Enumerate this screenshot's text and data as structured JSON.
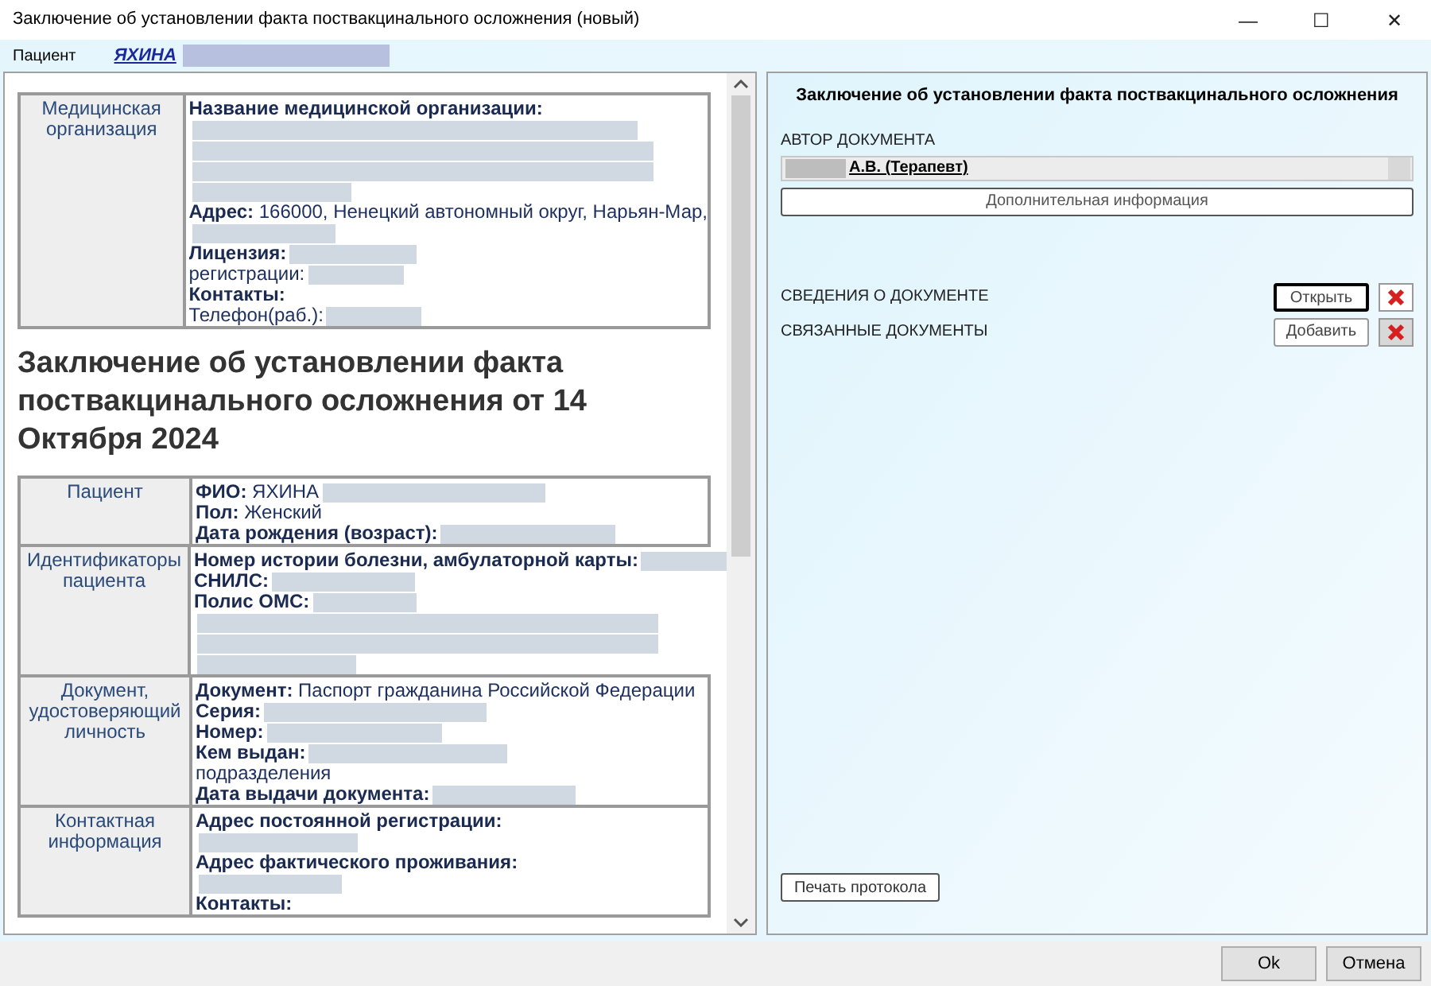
{
  "window": {
    "title": "Заключение об установлении факта поствакцинального осложнения (новый)",
    "controls": [
      "—",
      "☐",
      "✕"
    ]
  },
  "patient_bar": {
    "label": "Пациент",
    "name": "ЯХИНА"
  },
  "document": {
    "org_table": [
      {
        "label": "Медицинская организация",
        "lines": [
          {
            "kind": "field",
            "label": "Название медицинской организации:",
            "redacted": false
          },
          {
            "kind": "blur"
          },
          {
            "kind": "blur"
          },
          {
            "kind": "blur"
          },
          {
            "kind": "blur"
          },
          {
            "kind": "field",
            "label": "Адрес:",
            "value": "166000, Ненецкий автономный округ, Нарьян-Мар,",
            "redacted": false
          },
          {
            "kind": "blur"
          },
          {
            "kind": "field",
            "label": "Лицензия:",
            "redacted": true
          },
          {
            "kind": "text",
            "value": "регистрации:",
            "redacted": true
          },
          {
            "kind": "field",
            "label": "Контакты:",
            "redacted": false
          },
          {
            "kind": "text",
            "value": "Телефон(раб.):",
            "redacted": true
          }
        ]
      }
    ],
    "heading": "Заключение об установлении факта поствакцинального осложнения от 14 Октября 2024",
    "patient_table": [
      {
        "label": "Пациент",
        "lines": [
          {
            "kind": "field",
            "label": "ФИО:",
            "value": "ЯХИНА",
            "redacted": true
          },
          {
            "kind": "field",
            "label": "Пол:",
            "value": "Женский",
            "redacted": false
          },
          {
            "kind": "field",
            "label": "Дата рождения (возраст):",
            "redacted": true
          }
        ]
      },
      {
        "label": "Идентификаторы пациента",
        "lines": [
          {
            "kind": "field",
            "label": "Номер истории болезни, амбулаторной карты:",
            "redacted": true
          },
          {
            "kind": "field",
            "label": "СНИЛС:",
            "redacted": true
          },
          {
            "kind": "field",
            "label": "Полис ОМС:",
            "redacted": true
          },
          {
            "kind": "blur"
          },
          {
            "kind": "blur"
          },
          {
            "kind": "blur"
          }
        ]
      },
      {
        "label": "Документ, удостоверяющий личность",
        "lines": [
          {
            "kind": "field",
            "label": "Документ:",
            "value": "Паспорт гражданина Российской Федерации",
            "redacted": false
          },
          {
            "kind": "field",
            "label": "Серия:",
            "redacted": true
          },
          {
            "kind": "field",
            "label": "Номер:",
            "redacted": true
          },
          {
            "kind": "field",
            "label": "Кем выдан:",
            "redacted": true
          },
          {
            "kind": "text",
            "value": "подразделения",
            "redacted": false
          },
          {
            "kind": "field",
            "label": "Дата выдачи документа:",
            "redacted": true
          }
        ]
      },
      {
        "label": "Контактная информация",
        "lines": [
          {
            "kind": "field",
            "label": "Адрес постоянной регистрации:",
            "redacted": false
          },
          {
            "kind": "blur"
          },
          {
            "kind": "field",
            "label": "Адрес фактического проживания:",
            "redacted": false
          },
          {
            "kind": "blur"
          },
          {
            "kind": "field",
            "label": "Контакты:",
            "redacted": false
          }
        ]
      }
    ]
  },
  "side_panel": {
    "title": "Заключение об установлении факта поствакцинального осложнения",
    "author_label": "АВТОР ДОКУМЕНТА",
    "author_value": "А.В. (Терапевт)",
    "extra_button": "Дополнительная информация",
    "sections": [
      {
        "label": "СВЕДЕНИЯ О ДОКУМЕНТЕ",
        "button": "Открыть",
        "focused": true
      },
      {
        "label": "СВЯЗАННЫЕ ДОКУМЕНТЫ",
        "button": "Добавить",
        "focused": false
      }
    ],
    "print_button": "Печать протокола"
  },
  "footer": {
    "buttons": [
      "Ok",
      "Отмена"
    ]
  }
}
